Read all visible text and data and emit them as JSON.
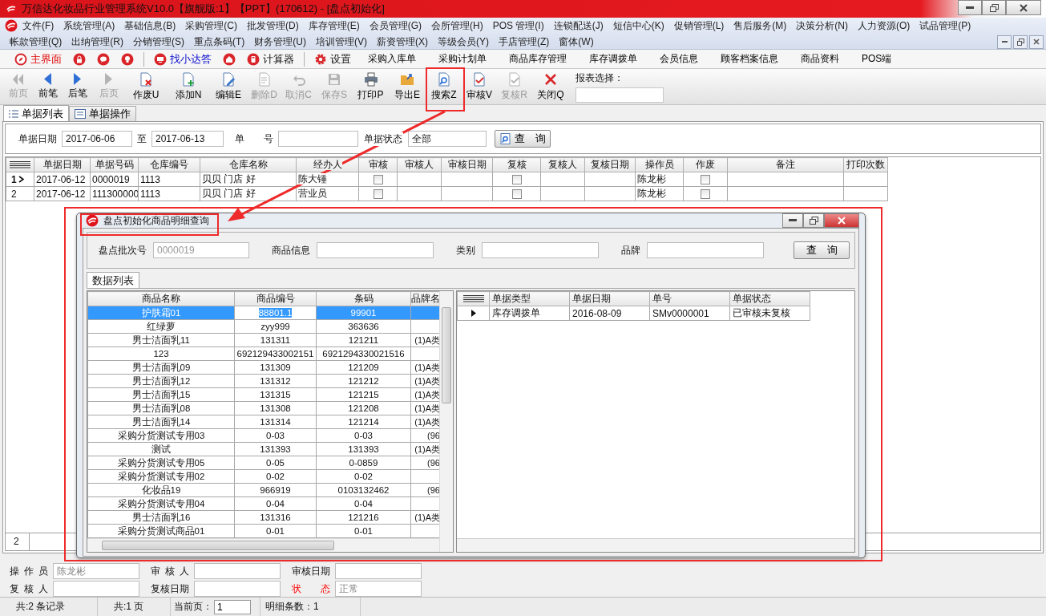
{
  "window": {
    "title": "万信达化妆品行业管理系统V10.0【旗舰版:1】【PPT】(170612) - [盘点初始化]"
  },
  "menu": {
    "rows": [
      [
        "文件(F)",
        "系统管理(A)",
        "基础信息(B)",
        "采购管理(C)",
        "批发管理(D)",
        "库存管理(E)",
        "会员管理(G)",
        "会所管理(H)",
        "POS 管理(I)",
        "连锁配送(J)",
        "短信中心(K)",
        "促销管理(L)",
        "售后服务(M)",
        "决策分析(N)",
        "人力资源(O)",
        "试品管理(P)"
      ],
      [
        "帐款管理(Q)",
        "出纳管理(R)",
        "分销管理(S)",
        "重点条码(T)",
        "财务管理(U)",
        "培训管理(V)",
        "薪资管理(X)",
        "等级会员(Y)",
        "手店管理(Z)",
        "窗体(W)"
      ]
    ]
  },
  "quick_bar": [
    {
      "kind": "alert",
      "label": "主界面"
    },
    {
      "kind": "icon"
    },
    {
      "kind": "icon"
    },
    {
      "kind": "icon"
    },
    {
      "kind": "separator"
    },
    {
      "kind": "accent",
      "label": "找小达答"
    },
    {
      "kind": "icon"
    },
    {
      "kind": "icon-text",
      "label": "计算器"
    },
    {
      "kind": "separator"
    },
    {
      "kind": "icon-text",
      "label": "设置"
    },
    {
      "kind": "text",
      "label": "采购入库单"
    },
    {
      "kind": "text",
      "label": "采购计划单"
    },
    {
      "kind": "text",
      "label": "商品库存管理"
    },
    {
      "kind": "text",
      "label": "库存调拨单"
    },
    {
      "kind": "text",
      "label": "会员信息"
    },
    {
      "kind": "text",
      "label": "顾客档案信息"
    },
    {
      "kind": "text",
      "label": "商品资料"
    },
    {
      "kind": "text",
      "label": "POS端"
    }
  ],
  "toolbar": {
    "buttons": [
      {
        "label": "前页",
        "disabled": true
      },
      {
        "label": "前笔",
        "disabled": false
      },
      {
        "label": "后笔",
        "disabled": false
      },
      {
        "label": "后页",
        "disabled": true
      },
      {
        "label": "作废U",
        "disabled": false
      },
      {
        "label": "添加N",
        "disabled": false
      },
      {
        "label": "编辑E",
        "disabled": false
      },
      {
        "label": "删除D",
        "disabled": true
      },
      {
        "label": "取消C",
        "disabled": true
      },
      {
        "label": "保存S",
        "disabled": true
      },
      {
        "label": "打印P",
        "disabled": false
      },
      {
        "label": "导出E",
        "disabled": false
      },
      {
        "label": "搜索Z",
        "disabled": false
      },
      {
        "label": "审核V",
        "disabled": false
      },
      {
        "label": "复核R",
        "disabled": true
      },
      {
        "label": "关闭Q",
        "disabled": false
      }
    ],
    "report_select": {
      "label": "报表选择："
    }
  },
  "tabs": [
    {
      "label": "单据列表",
      "selected": true
    },
    {
      "label": "单据操作",
      "selected": false
    }
  ],
  "filter": {
    "date_label": "单据日期",
    "date_from": "2017-06-06",
    "to_label": "至",
    "date_to": "2017-06-13",
    "number_label": "单　　号",
    "status_label": "单据状态",
    "status": "全部",
    "query_button": "查　询"
  },
  "table": {
    "columns": [
      "单据日期",
      "单据号码",
      "仓库编号",
      "仓库名称",
      "经办人",
      "审核",
      "审核人",
      "审核日期",
      "复核",
      "复核人",
      "复核日期",
      "操作员",
      "作废",
      "备注",
      "打印次数"
    ],
    "rows": [
      {
        "number": "1",
        "selected": true,
        "date": "2017-06-12",
        "doc_no": "0000019",
        "warehouse_code": "1113",
        "warehouse_name": "贝贝 门店 好",
        "handler": "陈大锤",
        "audited": false,
        "reviewed": false,
        "operator": "陈龙彬",
        "voided": false
      },
      {
        "number": "2",
        "selected": false,
        "date": "2017-06-12",
        "doc_no": "111300000",
        "warehouse_code": "1113",
        "warehouse_name": "贝贝 门店 好",
        "handler": "营业员",
        "audited": false,
        "reviewed": false,
        "operator": "陈龙彬",
        "voided": false
      }
    ],
    "footer_count": "2"
  },
  "detail_form": [
    {
      "label": "操作员",
      "value": "陈龙彬"
    },
    {
      "label": "审核人"
    },
    {
      "label": "审核日期"
    },
    {
      "label": "复核人"
    },
    {
      "label": "复核日期"
    },
    {
      "label": "状态",
      "value": "正常",
      "required": true
    }
  ],
  "status_bar": {
    "records": "共:2 条记录",
    "pages": "共:1 页",
    "current_label": "当前页：",
    "current_page": "1",
    "detail_count": "明细条数：1"
  },
  "dialog": {
    "title": "盘点初始化商品明细查询",
    "filters": [
      {
        "label": "盘点批次号",
        "value": "0000019",
        "disabled": true
      },
      {
        "label": "商品信息",
        "disabled": false
      },
      {
        "label": "类别",
        "disabled": false
      },
      {
        "label": "品牌",
        "disabled": false
      }
    ],
    "query_button": "查　询",
    "tab": "数据列表",
    "products": {
      "columns": [
        "商品名称",
        "商品编号",
        "条码",
        "品牌名"
      ],
      "rows": [
        {
          "selected": true,
          "name": "护肤霜01",
          "code": "88801.1",
          "barcode": "99901"
        },
        {
          "selected": false,
          "name": "红绿萝",
          "code": "zyy999",
          "barcode": "363636"
        },
        {
          "selected": false,
          "name": "男士洁面乳11",
          "code": "131311",
          "barcode": "121211",
          "brand": "(1)A类"
        },
        {
          "selected": false,
          "name": "123",
          "code": "692129433002151",
          "barcode": "6921294330021516"
        },
        {
          "selected": false,
          "name": "男士洁面乳09",
          "code": "131309",
          "barcode": "121209",
          "brand": "(1)A类"
        },
        {
          "selected": false,
          "name": "男士洁面乳12",
          "code": "131312",
          "barcode": "121212",
          "brand": "(1)A类"
        },
        {
          "selected": false,
          "name": "男士洁面乳15",
          "code": "131315",
          "barcode": "121215",
          "brand": "(1)A类"
        },
        {
          "selected": false,
          "name": "男士洁面乳08",
          "code": "131308",
          "barcode": "121208",
          "brand": "(1)A类"
        },
        {
          "selected": false,
          "name": "男士洁面乳14",
          "code": "131314",
          "barcode": "121214",
          "brand": "(1)A类"
        },
        {
          "selected": false,
          "name": "采购分货测试专用03",
          "code": "0-03",
          "barcode": "0-03",
          "brand": "(96"
        },
        {
          "selected": false,
          "name": "测试",
          "code": "131393",
          "barcode": "131393",
          "brand": "(1)A类"
        },
        {
          "selected": false,
          "name": "采购分货测试专用05",
          "code": "0-05",
          "barcode": "0-0859",
          "brand": "(96"
        },
        {
          "selected": false,
          "name": "采购分货测试专用02",
          "code": "0-02",
          "barcode": "0-02"
        },
        {
          "selected": false,
          "name": "化妆品19",
          "code": "966919",
          "barcode": "0103132462",
          "brand": "(96"
        },
        {
          "selected": false,
          "name": "采购分货测试专用04",
          "code": "0-04",
          "barcode": "0-04"
        },
        {
          "selected": false,
          "name": "男士洁面乳16",
          "code": "131316",
          "barcode": "121216",
          "brand": "(1)A类"
        },
        {
          "selected": false,
          "name": "采购分货测试商品01",
          "code": "0-01",
          "barcode": "0-01"
        }
      ]
    },
    "documents": {
      "columns": [
        "单据类型",
        "单据日期",
        "单号",
        "单据状态"
      ],
      "rows": [
        {
          "selected": true,
          "type": "库存调拨单",
          "date": "2016-08-09",
          "number": "SMv0000001",
          "status": "已审核未复核"
        }
      ]
    }
  }
}
